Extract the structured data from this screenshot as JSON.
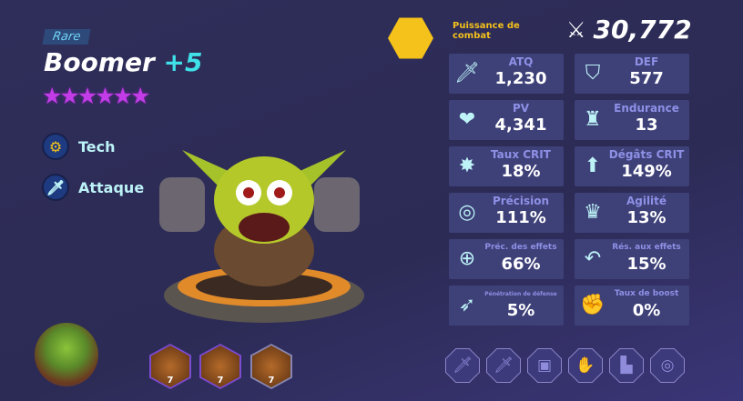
{
  "hero": {
    "rarity": "Rare",
    "name": "Boomer",
    "level": "+5",
    "stars": 6,
    "star_color": "#c23ce8",
    "traits": [
      {
        "icon": "gear-icon",
        "label": "Tech"
      },
      {
        "icon": "sword-icon",
        "label": "Attaque"
      }
    ]
  },
  "power": {
    "label": "Puissance de combat",
    "value": "30,772"
  },
  "stats": [
    {
      "icon": "sword-icon",
      "label": "ATQ",
      "value": "1,230"
    },
    {
      "icon": "shield-icon",
      "label": "DEF",
      "value": "577"
    },
    {
      "icon": "heart-icon",
      "label": "PV",
      "value": "4,341"
    },
    {
      "icon": "castle-shield-icon",
      "label": "Endurance",
      "value": "13"
    },
    {
      "icon": "burst-icon",
      "label": "Taux CRIT",
      "value": "18%"
    },
    {
      "icon": "arrow-up-icon",
      "label": "Dégâts CRIT",
      "value": "149%"
    },
    {
      "icon": "target-icon",
      "label": "Précision",
      "value": "111%"
    },
    {
      "icon": "crown-swirl-icon",
      "label": "Agilité",
      "value": "13%"
    },
    {
      "icon": "crosshair-icon",
      "label": "Préc. des effets",
      "value": "66%"
    },
    {
      "icon": "return-arrow-icon",
      "label": "Rés. aux effets",
      "value": "15%"
    },
    {
      "icon": "pierced-shield-icon",
      "label": "Pénétration de défense",
      "value": "5%"
    },
    {
      "icon": "fist-icon",
      "label": "Taux de boost",
      "value": "0%"
    }
  ],
  "skills": [
    {
      "level": "7"
    },
    {
      "level": "7"
    },
    {
      "level": "7"
    }
  ],
  "equipment": [
    "weapon-sword-icon",
    "weapon-sword-icon",
    "armor-icon",
    "glove-icon",
    "boot-icon",
    "ring-icon"
  ]
}
